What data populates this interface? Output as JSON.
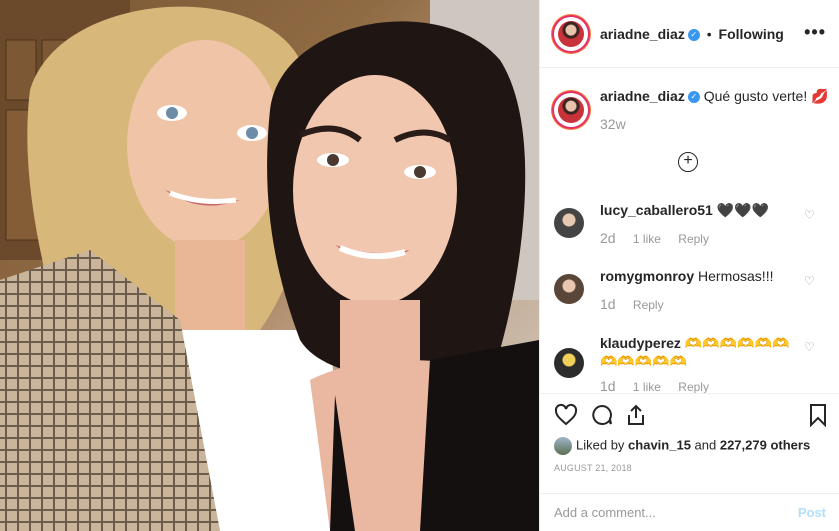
{
  "post": {
    "username": "ariadne_diaz",
    "follow_state": "Following",
    "more_label": "•••",
    "caption": "Qué gusto verte! 💋",
    "caption_age": "32w",
    "load_more": "+"
  },
  "comments": [
    {
      "username": "lucy_caballero51",
      "text": "🖤🖤🖤",
      "age": "2d",
      "likes": "1 like",
      "reply": "Reply"
    },
    {
      "username": "romygmonroy",
      "text": "Hermosas!!!",
      "age": "1d",
      "likes": "",
      "reply": "Reply"
    },
    {
      "username": "klaudyperez",
      "text": "🫶🫶🫶🫶🫶🫶🫶🫶🫶🫶🫶",
      "age": "1d",
      "likes": "1 like",
      "reply": "Reply"
    }
  ],
  "actions": {
    "likes_prefix": "Liked by ",
    "liked_by_user": "chavin_15",
    "likes_middle": " and ",
    "likes_count": "227,279 others",
    "date": "AUGUST 21, 2018",
    "comment_placeholder": "Add a comment...",
    "post_label": "Post"
  },
  "colors": {
    "accent": "#3897f0",
    "story_ring": "#e1306c",
    "post_disabled": "#b2dffc"
  },
  "icons": [
    "heart-icon",
    "comment-icon",
    "share-icon",
    "bookmark-icon",
    "verified-icon",
    "more-icon",
    "plus-circle-icon"
  ]
}
